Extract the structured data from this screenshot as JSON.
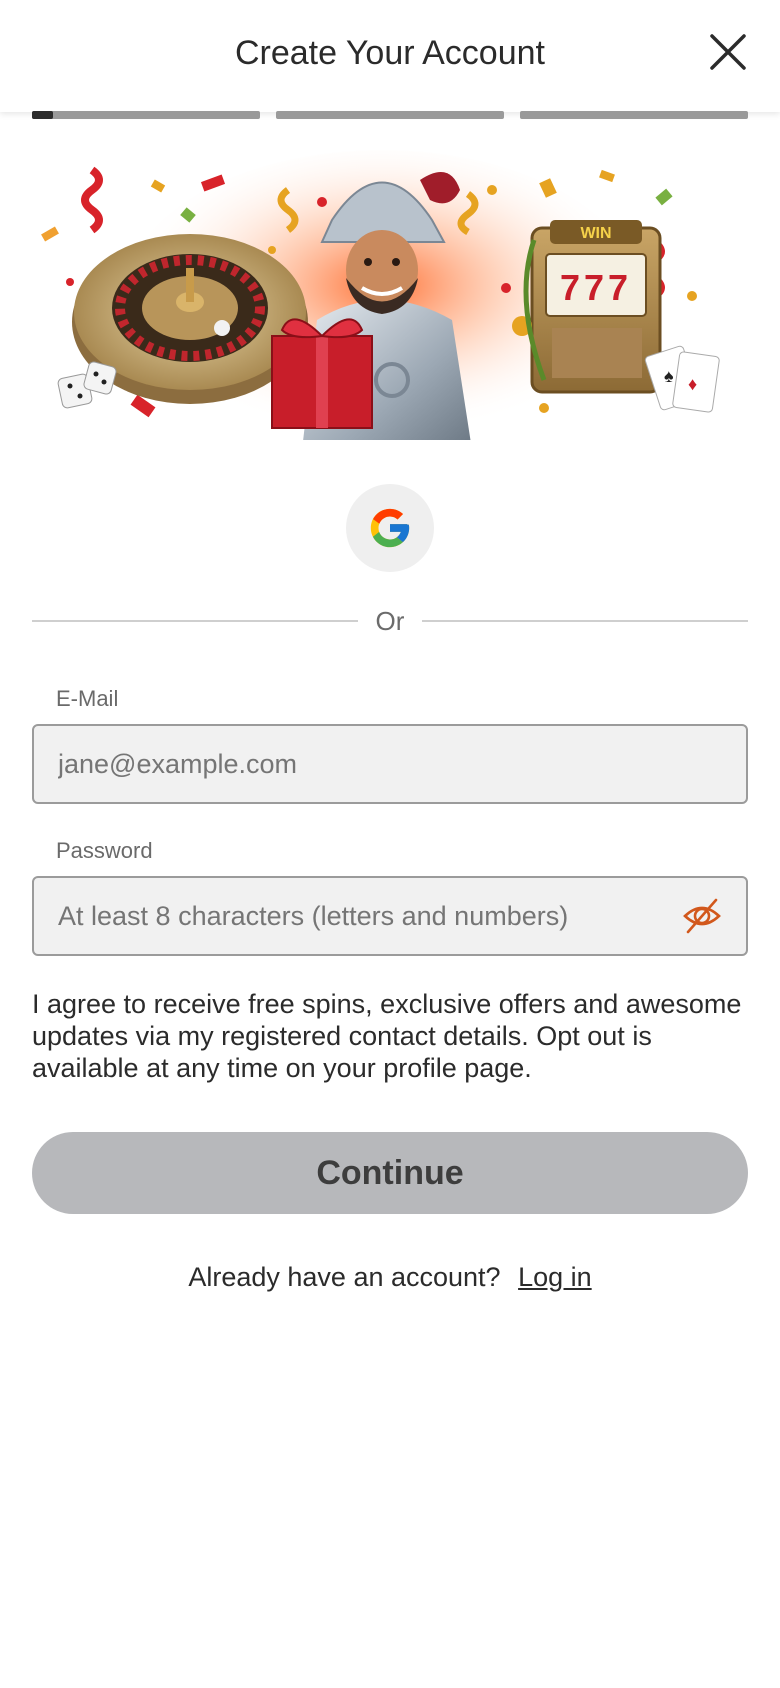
{
  "header": {
    "title": "Create Your Account",
    "close_icon": "close-icon"
  },
  "progress": {
    "step": 1,
    "total": 3,
    "first_step_fill": 0.09
  },
  "hero": {
    "alt": "",
    "banner_icon_text": "WIN",
    "slot_digits": "777"
  },
  "google": {
    "icon": "google-icon"
  },
  "divider": {
    "label": "Or"
  },
  "email": {
    "label": "E-Mail",
    "placeholder": "jane@example.com",
    "value": ""
  },
  "password": {
    "label": "Password",
    "placeholder": "At least 8 characters (letters and numbers)",
    "value": "",
    "toggle_icon": "eye-off-icon",
    "toggle_color": "#d2581c"
  },
  "consent": {
    "text": "I agree to receive free spins, exclusive offers and awesome updates via my registered contact details. Opt out is available at any time on your profile page."
  },
  "continue": {
    "label": "Continue",
    "color": "#b7b8bb"
  },
  "login": {
    "prompt": "Already have an account?",
    "link": "Log in"
  }
}
